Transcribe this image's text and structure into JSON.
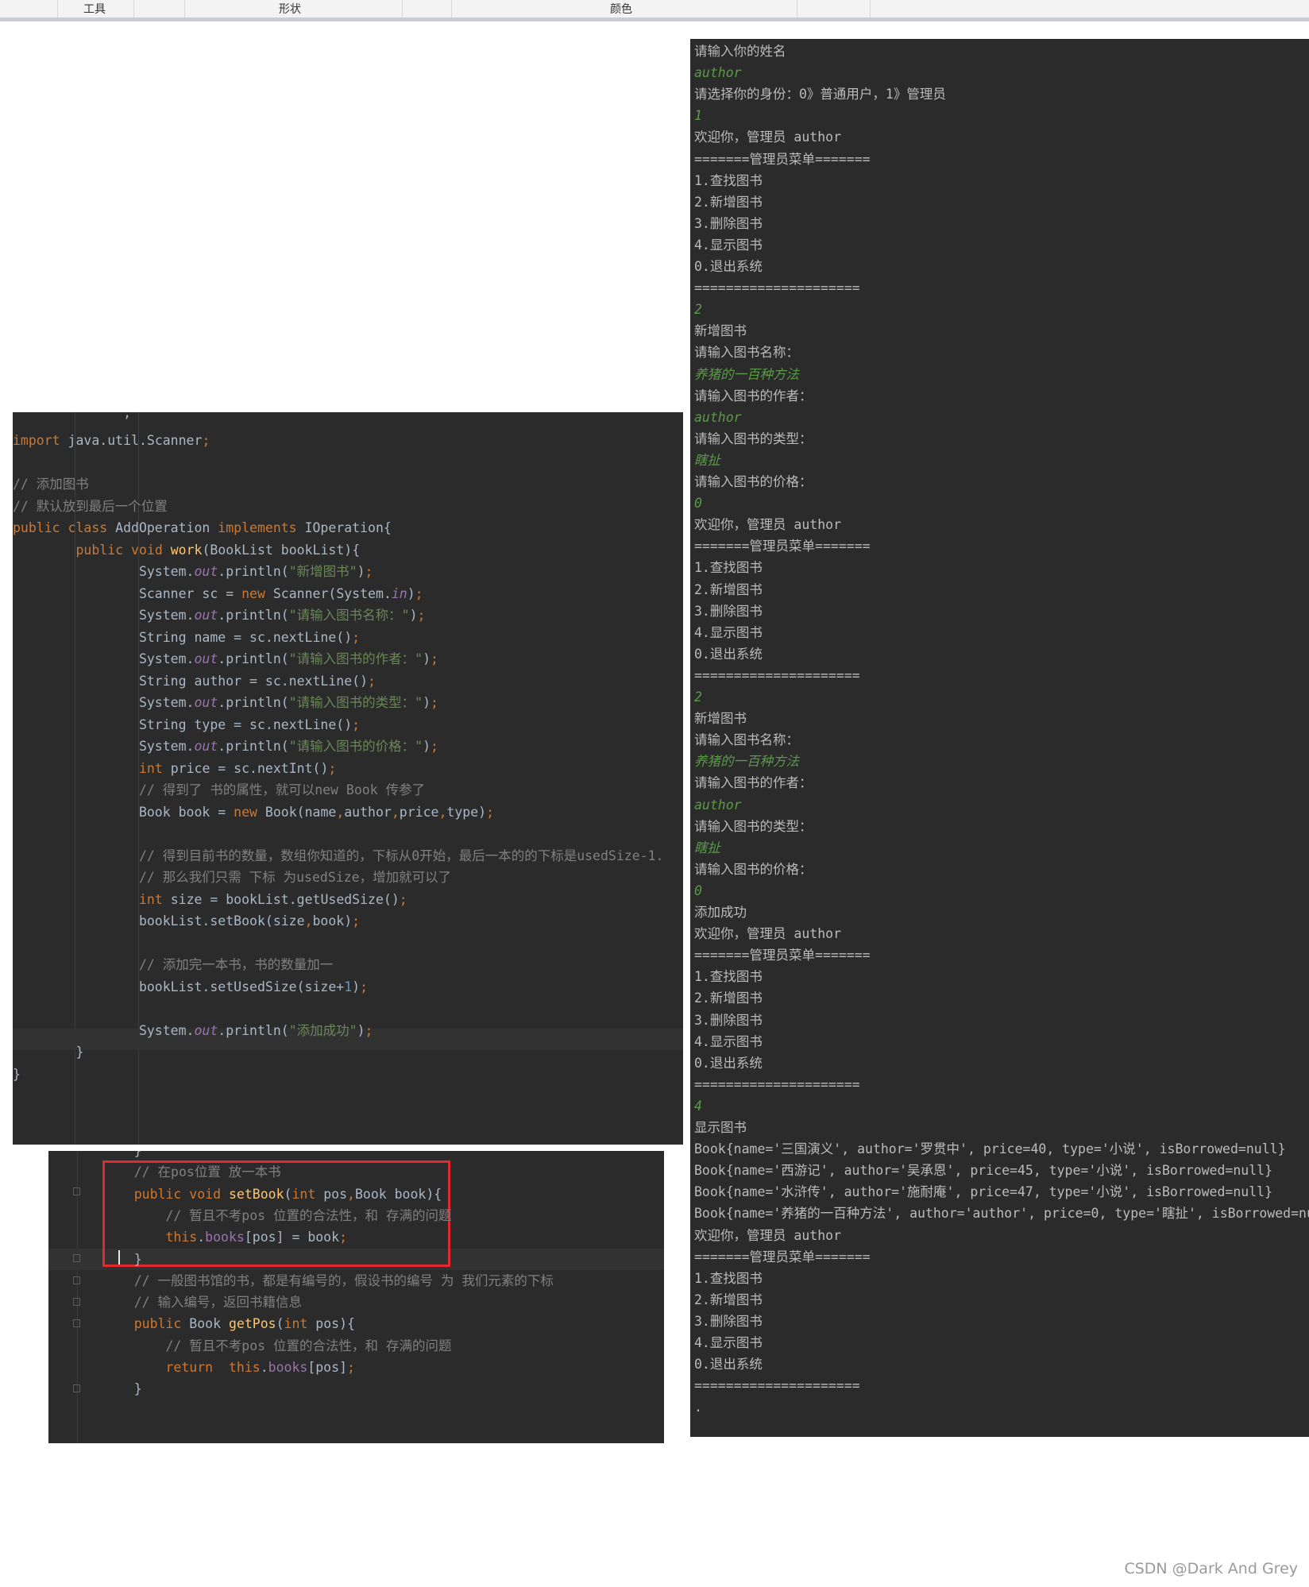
{
  "ribbon": {
    "tools": "工具",
    "shapes": "形状",
    "colors": "颜色"
  },
  "code_main": [
    {
      "segs": [
        {
          "c": "kw",
          "t": "import "
        },
        {
          "t": "java.util.Scanner"
        },
        {
          "c": "kw",
          "t": ";"
        }
      ]
    },
    {
      "segs": []
    },
    {
      "segs": [
        {
          "c": "cmt",
          "t": "// 添加图书"
        }
      ]
    },
    {
      "segs": [
        {
          "c": "cmt",
          "t": "// 默认放到最后一个位置"
        }
      ]
    },
    {
      "segs": [
        {
          "c": "kw",
          "t": "public class "
        },
        {
          "t": "AddOperation "
        },
        {
          "c": "kw",
          "t": "implements "
        },
        {
          "t": "IOperation{"
        }
      ]
    },
    {
      "segs": [
        {
          "t": "        "
        },
        {
          "c": "kw",
          "t": "public void "
        },
        {
          "c": "fn",
          "t": "work"
        },
        {
          "t": "(BookList bookList){"
        }
      ]
    },
    {
      "segs": [
        {
          "t": "                System."
        },
        {
          "c": "fld",
          "t": "out"
        },
        {
          "t": ".println("
        },
        {
          "c": "str",
          "t": "\"新增图书\""
        },
        {
          "t": ")"
        },
        {
          "c": "kw",
          "t": ";"
        }
      ]
    },
    {
      "segs": [
        {
          "t": "                Scanner sc = "
        },
        {
          "c": "kw",
          "t": "new "
        },
        {
          "t": "Scanner(System."
        },
        {
          "c": "fld",
          "t": "in"
        },
        {
          "t": ")"
        },
        {
          "c": "kw",
          "t": ";"
        }
      ]
    },
    {
      "segs": [
        {
          "t": "                System."
        },
        {
          "c": "fld",
          "t": "out"
        },
        {
          "t": ".println("
        },
        {
          "c": "str",
          "t": "\"请输入图书名称：\""
        },
        {
          "t": ")"
        },
        {
          "c": "kw",
          "t": ";"
        }
      ]
    },
    {
      "segs": [
        {
          "t": "                String name = sc.nextLine()"
        },
        {
          "c": "kw",
          "t": ";"
        }
      ]
    },
    {
      "segs": [
        {
          "t": "                System."
        },
        {
          "c": "fld",
          "t": "out"
        },
        {
          "t": ".println("
        },
        {
          "c": "str",
          "t": "\"请输入图书的作者：\""
        },
        {
          "t": ")"
        },
        {
          "c": "kw",
          "t": ";"
        }
      ]
    },
    {
      "segs": [
        {
          "t": "                String author = sc.nextLine()"
        },
        {
          "c": "kw",
          "t": ";"
        }
      ]
    },
    {
      "segs": [
        {
          "t": "                System."
        },
        {
          "c": "fld",
          "t": "out"
        },
        {
          "t": ".println("
        },
        {
          "c": "str",
          "t": "\"请输入图书的类型：\""
        },
        {
          "t": ")"
        },
        {
          "c": "kw",
          "t": ";"
        }
      ]
    },
    {
      "segs": [
        {
          "t": "                String type = sc.nextLine()"
        },
        {
          "c": "kw",
          "t": ";"
        }
      ]
    },
    {
      "segs": [
        {
          "t": "                System."
        },
        {
          "c": "fld",
          "t": "out"
        },
        {
          "t": ".println("
        },
        {
          "c": "str",
          "t": "\"请输入图书的价格：\""
        },
        {
          "t": ")"
        },
        {
          "c": "kw",
          "t": ";"
        }
      ]
    },
    {
      "segs": [
        {
          "t": "                "
        },
        {
          "c": "kw",
          "t": "int "
        },
        {
          "t": "price = sc.nextInt()"
        },
        {
          "c": "kw",
          "t": ";"
        }
      ]
    },
    {
      "segs": [
        {
          "t": "                "
        },
        {
          "c": "cmt",
          "t": "// 得到了 书的属性，就可以new Book 传参了"
        }
      ]
    },
    {
      "segs": [
        {
          "t": "                Book book = "
        },
        {
          "c": "kw",
          "t": "new "
        },
        {
          "t": "Book(name"
        },
        {
          "c": "kw",
          "t": ","
        },
        {
          "t": "author"
        },
        {
          "c": "kw",
          "t": ","
        },
        {
          "t": "price"
        },
        {
          "c": "kw",
          "t": ","
        },
        {
          "t": "type)"
        },
        {
          "c": "kw",
          "t": ";"
        }
      ]
    },
    {
      "segs": []
    },
    {
      "segs": [
        {
          "t": "                "
        },
        {
          "c": "cmt",
          "t": "// 得到目前书的数量，数组你知道的，下标从0开始，最后一本的的下标是usedSize-1."
        }
      ]
    },
    {
      "segs": [
        {
          "t": "                "
        },
        {
          "c": "cmt",
          "t": "// 那么我们只需 下标 为usedSize，增加就可以了"
        }
      ]
    },
    {
      "segs": [
        {
          "t": "                "
        },
        {
          "c": "kw",
          "t": "int "
        },
        {
          "t": "size = bookList.getUsedSize()"
        },
        {
          "c": "kw",
          "t": ";"
        }
      ]
    },
    {
      "segs": [
        {
          "t": "                bookList.setBook(size"
        },
        {
          "c": "kw",
          "t": ","
        },
        {
          "t": "book)"
        },
        {
          "c": "kw",
          "t": ";"
        }
      ]
    },
    {
      "segs": []
    },
    {
      "segs": [
        {
          "t": "                "
        },
        {
          "c": "cmt",
          "t": "// 添加完一本书，书的数量加一"
        }
      ]
    },
    {
      "segs": [
        {
          "t": "                bookList.setUsedSize(size+"
        },
        {
          "c": "num",
          "t": "1"
        },
        {
          "t": ")"
        },
        {
          "c": "kw",
          "t": ";"
        }
      ]
    },
    {
      "segs": []
    },
    {
      "segs": [
        {
          "t": "                System."
        },
        {
          "c": "fld",
          "t": "out"
        },
        {
          "t": ".println("
        },
        {
          "c": "str",
          "t": "\"添加成功\""
        },
        {
          "t": ")"
        },
        {
          "c": "kw",
          "t": ";"
        }
      ]
    },
    {
      "segs": [
        {
          "t": "        }"
        }
      ]
    },
    {
      "segs": [
        {
          "t": "}"
        }
      ]
    }
  ],
  "code_snippet": [
    {
      "segs": [
        {
          "t": "    }"
        }
      ]
    },
    {
      "segs": [
        {
          "t": "    "
        },
        {
          "c": "cmt",
          "t": "// 在pos位置 放一本书"
        }
      ]
    },
    {
      "segs": [
        {
          "t": "    "
        },
        {
          "c": "kw",
          "t": "public void "
        },
        {
          "c": "fn",
          "t": "setBook"
        },
        {
          "t": "("
        },
        {
          "c": "kw",
          "t": "int "
        },
        {
          "t": "pos"
        },
        {
          "c": "kw",
          "t": ","
        },
        {
          "t": "Book book){"
        }
      ]
    },
    {
      "segs": [
        {
          "t": "        "
        },
        {
          "c": "cmt",
          "t": "// 暂且不考pos 位置的合法性，和 存满的问题"
        }
      ]
    },
    {
      "segs": [
        {
          "t": "        "
        },
        {
          "c": "kw",
          "t": "this"
        },
        {
          "t": "."
        },
        {
          "c": "pfld",
          "t": "books"
        },
        {
          "t": "[pos] = book"
        },
        {
          "c": "kw",
          "t": ";"
        }
      ]
    },
    {
      "segs": [
        {
          "t": "    }"
        }
      ]
    },
    {
      "segs": [
        {
          "t": "    "
        },
        {
          "c": "cmt",
          "t": "// 一般图书馆的书，都是有编号的，假设书的编号 为 我们元素的下标"
        }
      ]
    },
    {
      "segs": [
        {
          "t": "    "
        },
        {
          "c": "cmt",
          "t": "// 输入编号，返回书籍信息"
        }
      ]
    },
    {
      "segs": [
        {
          "t": "    "
        },
        {
          "c": "kw",
          "t": "public "
        },
        {
          "t": "Book "
        },
        {
          "c": "fn",
          "t": "getPos"
        },
        {
          "t": "("
        },
        {
          "c": "kw",
          "t": "int "
        },
        {
          "t": "pos){"
        }
      ]
    },
    {
      "segs": [
        {
          "t": "        "
        },
        {
          "c": "cmt",
          "t": "// 暂且不考pos 位置的合法性，和 存满的问题"
        }
      ]
    },
    {
      "segs": [
        {
          "t": "        "
        },
        {
          "c": "kw",
          "t": "return  this"
        },
        {
          "t": "."
        },
        {
          "c": "pfld",
          "t": "books"
        },
        {
          "t": "[pos]"
        },
        {
          "c": "kw",
          "t": ";"
        }
      ]
    },
    {
      "segs": [
        {
          "t": "    }"
        }
      ]
    }
  ],
  "console": [
    {
      "t": "请输入你的姓名"
    },
    {
      "t": "author",
      "in": true
    },
    {
      "t": "请选择你的身份：0》普通用户，1》管理员"
    },
    {
      "t": "1",
      "in": true
    },
    {
      "t": "欢迎你，管理员 author"
    },
    {
      "t": "=======管理员菜单======="
    },
    {
      "t": "1.查找图书"
    },
    {
      "t": "2.新增图书"
    },
    {
      "t": "3.删除图书"
    },
    {
      "t": "4.显示图书"
    },
    {
      "t": "0.退出系统"
    },
    {
      "t": "====================="
    },
    {
      "t": "2",
      "in": true
    },
    {
      "t": "新增图书"
    },
    {
      "t": "请输入图书名称："
    },
    {
      "t": "养猪的一百种方法",
      "in": true
    },
    {
      "t": "请输入图书的作者："
    },
    {
      "t": "author",
      "in": true
    },
    {
      "t": "请输入图书的类型："
    },
    {
      "t": "瞎扯",
      "in": true
    },
    {
      "t": "请输入图书的价格："
    },
    {
      "t": "0",
      "in": true
    },
    {
      "t": "欢迎你，管理员 author"
    },
    {
      "t": "=======管理员菜单======="
    },
    {
      "t": "1.查找图书"
    },
    {
      "t": "2.新增图书"
    },
    {
      "t": "3.删除图书"
    },
    {
      "t": "4.显示图书"
    },
    {
      "t": "0.退出系统"
    },
    {
      "t": "====================="
    },
    {
      "t": "2",
      "in": true
    },
    {
      "t": "新增图书"
    },
    {
      "t": "请输入图书名称："
    },
    {
      "t": "养猪的一百种方法",
      "in": true
    },
    {
      "t": "请输入图书的作者："
    },
    {
      "t": "author",
      "in": true
    },
    {
      "t": "请输入图书的类型："
    },
    {
      "t": "瞎扯",
      "in": true
    },
    {
      "t": "请输入图书的价格："
    },
    {
      "t": "0",
      "in": true
    },
    {
      "t": "添加成功"
    },
    {
      "t": "欢迎你，管理员 author"
    },
    {
      "t": "=======管理员菜单======="
    },
    {
      "t": "1.查找图书"
    },
    {
      "t": "2.新增图书"
    },
    {
      "t": "3.删除图书"
    },
    {
      "t": "4.显示图书"
    },
    {
      "t": "0.退出系统"
    },
    {
      "t": "====================="
    },
    {
      "t": "4",
      "in": true
    },
    {
      "t": "显示图书"
    },
    {
      "t": "Book{name='三国演义', author='罗贯中', price=40, type='小说', isBorrowed=null}"
    },
    {
      "t": "Book{name='西游记', author='吴承恩', price=45, type='小说', isBorrowed=null}"
    },
    {
      "t": "Book{name='水浒传', author='施耐庵', price=47, type='小说', isBorrowed=null}"
    },
    {
      "t": "Book{name='养猪的一百种方法', author='author', price=0, type='瞎扯', isBorrowed=nu"
    },
    {
      "t": "欢迎你，管理员 author"
    },
    {
      "t": "=======管理员菜单======="
    },
    {
      "t": "1.查找图书"
    },
    {
      "t": "2.新增图书"
    },
    {
      "t": "3.删除图书"
    },
    {
      "t": "4.显示图书"
    },
    {
      "t": "0.退出系统"
    },
    {
      "t": "====================="
    },
    {
      "t": "."
    }
  ],
  "watermark": "CSDN @Dark And Grey",
  "colors": {
    "editor_bg": "#2b2b2b",
    "keyword": "#cc7832",
    "string": "#6a8759",
    "comment": "#808080",
    "field": "#9876aa",
    "function": "#ffc66d",
    "console_input": "#5a9a48",
    "highlight_box": "#e0282e"
  }
}
